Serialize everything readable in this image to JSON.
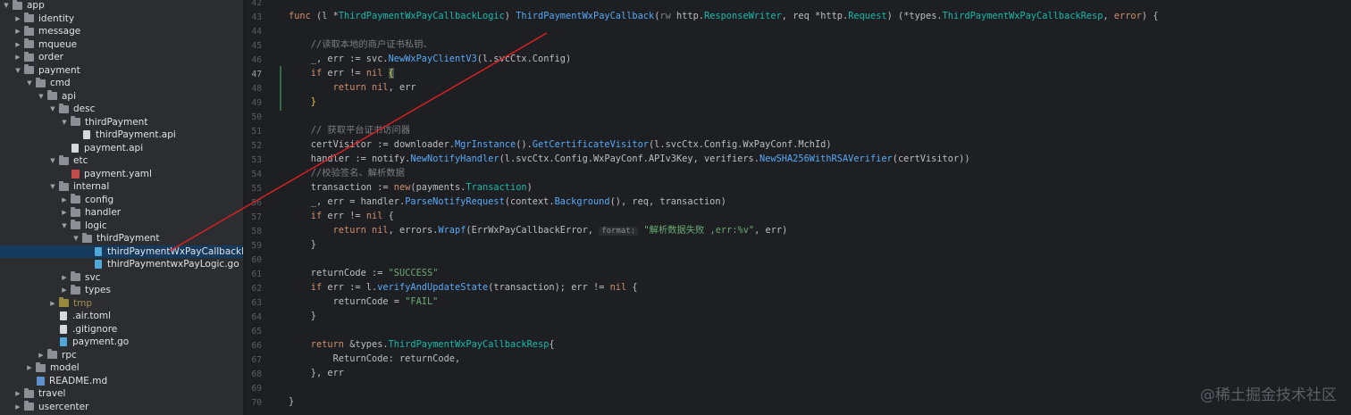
{
  "file_tree": [
    {
      "label": "app",
      "level": 0,
      "type": "folder",
      "open": true
    },
    {
      "label": "identity",
      "level": 1,
      "type": "folder",
      "open": false
    },
    {
      "label": "message",
      "level": 1,
      "type": "folder",
      "open": false
    },
    {
      "label": "mqueue",
      "level": 1,
      "type": "folder",
      "open": false
    },
    {
      "label": "order",
      "level": 1,
      "type": "folder",
      "open": false
    },
    {
      "label": "payment",
      "level": 1,
      "type": "folder",
      "open": true
    },
    {
      "label": "cmd",
      "level": 2,
      "type": "folder",
      "open": true
    },
    {
      "label": "api",
      "level": 3,
      "type": "folder",
      "open": true
    },
    {
      "label": "desc",
      "level": 4,
      "type": "folder",
      "open": true
    },
    {
      "label": "thirdPayment",
      "level": 5,
      "type": "folder",
      "open": true
    },
    {
      "label": "thirdPayment.api",
      "level": 6,
      "type": "file"
    },
    {
      "label": "payment.api",
      "level": 5,
      "type": "file"
    },
    {
      "label": "etc",
      "level": 4,
      "type": "folder",
      "open": true
    },
    {
      "label": "payment.yaml",
      "level": 5,
      "type": "yaml"
    },
    {
      "label": "internal",
      "level": 4,
      "type": "folder",
      "open": true
    },
    {
      "label": "config",
      "level": 5,
      "type": "folder",
      "open": false
    },
    {
      "label": "handler",
      "level": 5,
      "type": "folder",
      "open": false
    },
    {
      "label": "logic",
      "level": 5,
      "type": "folder",
      "open": true
    },
    {
      "label": "thirdPayment",
      "level": 6,
      "type": "folder",
      "open": true
    },
    {
      "label": "thirdPaymentWxPayCallbackLogic",
      "level": 7,
      "type": "go",
      "selected": true
    },
    {
      "label": "thirdPaymentwxPayLogic.go",
      "level": 7,
      "type": "go"
    },
    {
      "label": "svc",
      "level": 5,
      "type": "folder",
      "open": false
    },
    {
      "label": "types",
      "level": 5,
      "type": "folder",
      "open": false
    },
    {
      "label": "tmp",
      "level": 4,
      "type": "folder",
      "open": false,
      "dim": true
    },
    {
      "label": ".air.toml",
      "level": 4,
      "type": "file"
    },
    {
      "label": ".gitignore",
      "level": 4,
      "type": "file"
    },
    {
      "label": "payment.go",
      "level": 4,
      "type": "go"
    },
    {
      "label": "rpc",
      "level": 3,
      "type": "folder",
      "open": false
    },
    {
      "label": "model",
      "level": 2,
      "type": "folder",
      "open": false
    },
    {
      "label": "README.md",
      "level": 2,
      "type": "md"
    },
    {
      "label": "travel",
      "level": 1,
      "type": "folder",
      "open": false
    },
    {
      "label": "usercenter",
      "level": 1,
      "type": "folder",
      "open": false
    }
  ],
  "line_numbers": [
    "42",
    "43",
    "44",
    "45",
    "46",
    "47",
    "48",
    "49",
    "50",
    "51",
    "52",
    "53",
    "54",
    "55",
    "56",
    "57",
    "58",
    "59",
    "60",
    "61",
    "62",
    "63",
    "64",
    "65",
    "66",
    "67",
    "68",
    "69",
    "70"
  ],
  "current_line": "47",
  "code_lines": [
    [],
    [
      [
        "kw",
        "func "
      ],
      [
        "",
        "(l "
      ],
      [
        "",
        "*"
      ],
      [
        "ty",
        "ThirdPaymentWxPayCallbackLogic"
      ],
      [
        "",
        ") "
      ],
      [
        "fd",
        "ThirdPaymentWxPayCallback"
      ],
      [
        "",
        "("
      ],
      [
        "pr",
        "rw "
      ],
      [
        "pkg",
        "http."
      ],
      [
        "ty",
        "ResponseWriter"
      ],
      [
        "",
        ", req *http."
      ],
      [
        "ty",
        "Request"
      ],
      [
        "",
        ") (*types."
      ],
      [
        "ty",
        "ThirdPaymentWxPayCallbackResp"
      ],
      [
        "",
        ", "
      ],
      [
        "kw",
        "error"
      ],
      [
        "",
        ") {"
      ]
    ],
    [],
    [
      [
        "cm",
        "    //读取本地的商户证书私钥、"
      ]
    ],
    [
      [
        "",
        "    _, err := svc."
      ],
      [
        "fn",
        "NewWxPayClientV3"
      ],
      [
        "",
        "(l.svcCtx.Config)"
      ]
    ],
    [
      [
        "kw",
        "    if "
      ],
      [
        "",
        "err != "
      ],
      [
        "kw",
        "nil "
      ],
      [
        "brace",
        "{"
      ]
    ],
    [
      [
        "kw",
        "        return "
      ],
      [
        "kw",
        "nil"
      ],
      [
        "",
        ", err"
      ]
    ],
    [
      [
        "bry",
        "    }"
      ]
    ],
    [],
    [
      [
        "cm",
        "    // 获取平台证书访问器"
      ]
    ],
    [
      [
        "",
        "    certVisitor := downloader."
      ],
      [
        "fn",
        "MgrInstance"
      ],
      [
        "",
        "()."
      ],
      [
        "fn",
        "GetCertificateVisitor"
      ],
      [
        "",
        "(l.svcCtx.Config.WxPayConf.MchId)"
      ]
    ],
    [
      [
        "",
        "    handler := notify."
      ],
      [
        "fn",
        "NewNotifyHandler"
      ],
      [
        "",
        "(l.svcCtx.Config.WxPayConf.APIv3Key, verifiers."
      ],
      [
        "fn",
        "NewSHA256WithRSAVerifier"
      ],
      [
        "",
        "(certVisitor))"
      ]
    ],
    [
      [
        "cm",
        "    //校验签名、解析数据"
      ]
    ],
    [
      [
        "",
        "    transaction := "
      ],
      [
        "kw",
        "new"
      ],
      [
        "",
        "(payments."
      ],
      [
        "ty",
        "Transaction"
      ],
      [
        "",
        ")"
      ]
    ],
    [
      [
        "",
        "    _, err = handler."
      ],
      [
        "fn",
        "ParseNotifyRequest"
      ],
      [
        "",
        "(context."
      ],
      [
        "fn",
        "Background"
      ],
      [
        "",
        "(), req, transaction)"
      ]
    ],
    [
      [
        "kw",
        "    if "
      ],
      [
        "",
        "err != "
      ],
      [
        "kw",
        "nil "
      ],
      [
        "",
        "{"
      ]
    ],
    [
      [
        "kw",
        "        return "
      ],
      [
        "kw",
        "nil"
      ],
      [
        "",
        ", errors."
      ],
      [
        "fn",
        "Wrapf"
      ],
      [
        "",
        "(ErrWxPayCallbackError, "
      ],
      [
        "hint",
        "format:"
      ],
      [
        "st",
        " \"解析数据失败 ,err:%v\""
      ],
      [
        "",
        ", err)"
      ]
    ],
    [
      [
        "",
        "    }"
      ]
    ],
    [],
    [
      [
        "",
        "    returnCode := "
      ],
      [
        "st",
        "\"SUCCESS\""
      ]
    ],
    [
      [
        "kw",
        "    if "
      ],
      [
        "",
        "err := l."
      ],
      [
        "fn",
        "verifyAndUpdateState"
      ],
      [
        "",
        "(transaction); err != "
      ],
      [
        "kw",
        "nil "
      ],
      [
        "",
        "{"
      ]
    ],
    [
      [
        "",
        "        returnCode = "
      ],
      [
        "st",
        "\"FAIL\""
      ]
    ],
    [
      [
        "",
        "    }"
      ]
    ],
    [],
    [
      [
        "kw",
        "    return "
      ],
      [
        "",
        "&types."
      ],
      [
        "ty",
        "ThirdPaymentWxPayCallbackResp"
      ],
      [
        "",
        "{"
      ]
    ],
    [
      [
        "",
        "        ReturnCode: returnCode,"
      ]
    ],
    [
      [
        "",
        "    }, err"
      ]
    ],
    [],
    [
      [
        "",
        "}"
      ]
    ]
  ],
  "colors": {
    "arrow": "#e02020",
    "selection": "#163a5c",
    "editor_bg": "#1e1f22",
    "sidebar_bg": "#2b2d30"
  },
  "watermark": "@稀土掘金技术社区"
}
